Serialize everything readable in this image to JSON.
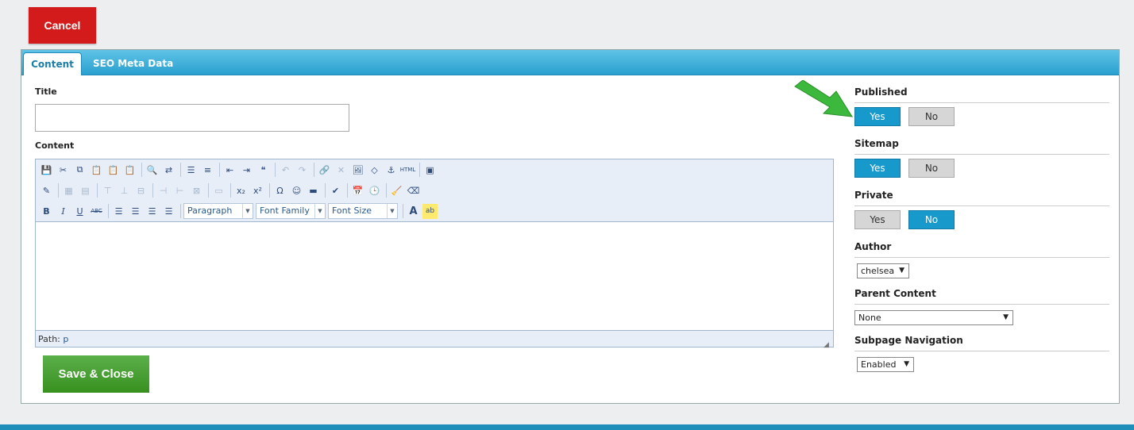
{
  "header": {
    "cancel_label": "Cancel"
  },
  "tabs": [
    {
      "label": "Content",
      "active": true
    },
    {
      "label": "SEO Meta Data",
      "active": false
    }
  ],
  "form": {
    "title_label": "Title",
    "title_value": "",
    "content_label": "Content",
    "editor": {
      "row1_icons": [
        "save-icon",
        "cut-icon",
        "copy-icon",
        "paste-icon",
        "paste-text-icon",
        "paste-word-icon",
        "find-icon",
        "replace-icon",
        "bullet-list-icon",
        "numbered-list-icon",
        "outdent-icon",
        "indent-icon",
        "blockquote-icon",
        "undo-icon",
        "redo-icon",
        "link-icon",
        "unlink-icon",
        "image-icon",
        "code-icon",
        "anchor-icon",
        "html-icon",
        "fullscreen-icon"
      ],
      "row3": {
        "bold": "B",
        "italic": "I",
        "underline": "U",
        "strike": "ABC",
        "format_select": "Paragraph",
        "font_family_select": "Font Family",
        "font_size_select": "Font Size",
        "font_color": "A",
        "highlight": "ab"
      },
      "path_label": "Path:",
      "path_value": "p"
    },
    "save_label": "Save & Close"
  },
  "sidebar": {
    "published": {
      "label": "Published",
      "yes": "Yes",
      "no": "No",
      "value": "Yes"
    },
    "sitemap": {
      "label": "Sitemap",
      "yes": "Yes",
      "no": "No",
      "value": "Yes"
    },
    "private": {
      "label": "Private",
      "yes": "Yes",
      "no": "No",
      "value": "No"
    },
    "author": {
      "label": "Author",
      "value": "chelsea"
    },
    "parent_content": {
      "label": "Parent Content",
      "value": "None"
    },
    "subpage_navigation": {
      "label": "Subpage Navigation",
      "value": "Enabled"
    }
  },
  "colors": {
    "accent": "#1899cc",
    "cancel": "#d41b1b",
    "save": "#4aa336",
    "arrow": "#3cb83c"
  }
}
